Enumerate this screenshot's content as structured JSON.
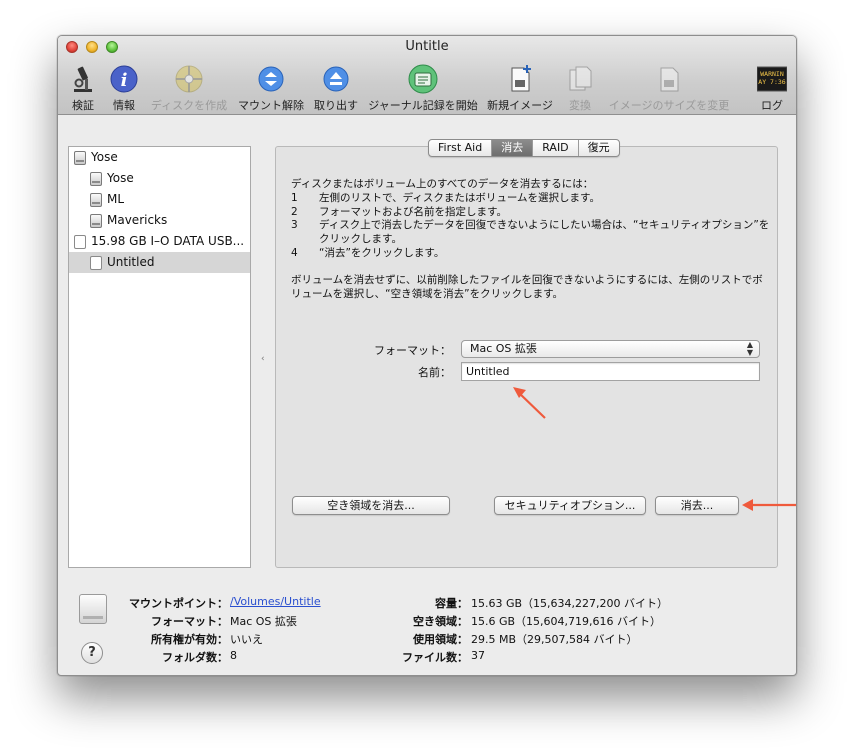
{
  "window": {
    "title": "Untitle"
  },
  "toolbar": {
    "verify": "検証",
    "info": "情報",
    "burn": "ディスクを作成",
    "unmount": "マウント解除",
    "eject": "取り出す",
    "journal": "ジャーナル記録を開始",
    "new_image": "新規イメージ",
    "convert": "変換",
    "resize": "イメージのサイズを変更",
    "log": "ログ",
    "log_badge_top": "WARNIN",
    "log_badge_bottom": "AY 7:36"
  },
  "sidebar": {
    "items": [
      {
        "label": "Yose"
      },
      {
        "label": "Yose"
      },
      {
        "label": "ML"
      },
      {
        "label": "Mavericks"
      },
      {
        "label": "15.98 GB I–O DATA USB..."
      },
      {
        "label": "Untitled"
      }
    ]
  },
  "tabs": [
    "First Aid",
    "消去",
    "RAID",
    "復元"
  ],
  "erase": {
    "intro": "ディスクまたはボリューム上のすべてのデータを消去するには：",
    "steps": [
      {
        "num": "1",
        "text": "左側のリストで、ディスクまたはボリュームを選択します。"
      },
      {
        "num": "2",
        "text": "フォーマットおよび名前を指定します。"
      },
      {
        "num": "3",
        "text": "ディスク上で消去したデータを回復できないようにしたい場合は、“セキュリティオプション”をクリックします。"
      },
      {
        "num": "4",
        "text": "“消去”をクリックします。"
      }
    ],
    "para2": "ボリュームを消去せずに、以前削除したファイルを回復できないようにするには、左側のリストでボリュームを選択し、“空き領域を消去”をクリックします。",
    "format_label": "フォーマット：",
    "format_value": "Mac OS 拡張",
    "name_label": "名前：",
    "name_value": "Untitled",
    "erase_free_space": "空き領域を消去...",
    "security_options": "セキュリティオプション...",
    "erase_button": "消去..."
  },
  "info": {
    "mount_point_label": "マウントポイント：",
    "mount_point_value": "/Volumes/Untitle",
    "format_label": "フォーマット：",
    "format_value": "Mac OS 拡張",
    "owners_label": "所有権が有効：",
    "owners_value": "いいえ",
    "folders_label": "フォルダ数：",
    "folders_value": "8",
    "capacity_label": "容量：",
    "capacity_value": "15.63 GB（15,634,227,200 バイト）",
    "available_label": "空き領域：",
    "available_value": "15.6 GB（15,604,719,616 バイト）",
    "used_label": "使用領域：",
    "used_value": "29.5 MB（29,507,584 バイト）",
    "files_label": "ファイル数：",
    "files_value": "37"
  },
  "colors": {
    "annotation_arrow": "#ef5a3c",
    "link": "#2a4fcf"
  }
}
